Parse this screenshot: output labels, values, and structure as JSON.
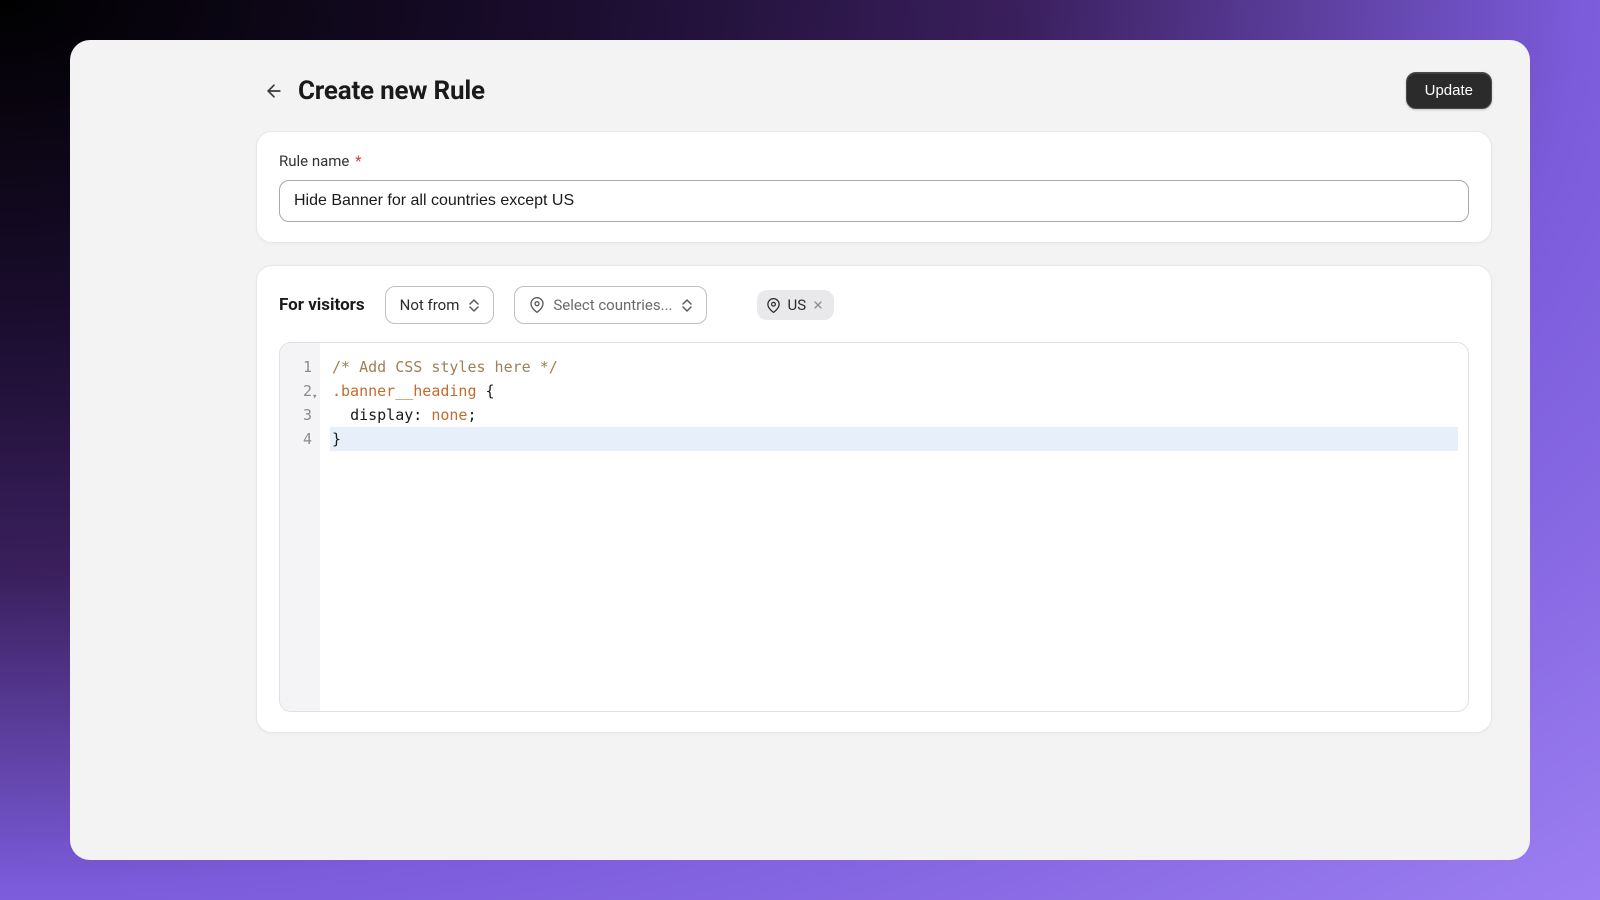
{
  "header": {
    "title": "Create new Rule",
    "update_label": "Update"
  },
  "rule_name": {
    "label": "Rule name",
    "required_mark": "*",
    "value": "Hide Banner for all countries except US"
  },
  "visitors": {
    "label": "For visitors",
    "condition_select": "Not from",
    "country_placeholder": "Select countries...",
    "selected_tags": [
      {
        "label": "US"
      }
    ]
  },
  "editor": {
    "line_numbers": [
      "1",
      "2",
      "3",
      "4"
    ],
    "lines": {
      "l1_comment": "/* Add CSS styles here */",
      "l2_selector": ".banner__heading",
      "l2_brace_open": " {",
      "l3_indent": "  ",
      "l3_property": "display",
      "l3_colon": ": ",
      "l3_value": "none",
      "l3_semi": ";",
      "l4_brace_close": "}"
    }
  }
}
